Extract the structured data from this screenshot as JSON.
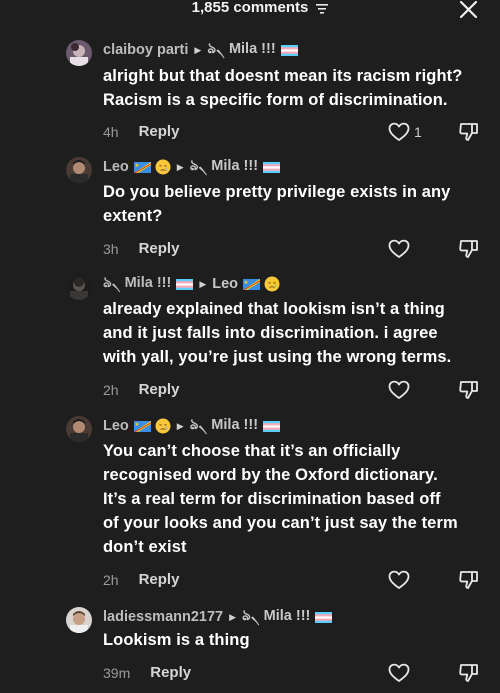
{
  "header": {
    "title": "1,855 comments"
  },
  "comments": [
    {
      "author": "claiboy parti",
      "reply_to": "ঌ৲ Mila !!!",
      "text_lines": [
        "alright but that doesnt mean its racism right?",
        "Racism is a specific form of discrimination."
      ],
      "time": "4h",
      "reply_label": "Reply",
      "like_count": "1"
    },
    {
      "author": "Leo",
      "reply_to": "ঌ৲ Mila !!!",
      "text_lines": [
        "Do you believe pretty privilege exists in any",
        "extent?"
      ],
      "time": "3h",
      "reply_label": "Reply",
      "like_count": ""
    },
    {
      "author": "ঌ৲ Mila !!!",
      "reply_to": "Leo",
      "text_lines": [
        "already explained that lookism isn’t a thing",
        "and it just falls into discrimination. i agree",
        "with yall, you’re just using the wrong terms."
      ],
      "time": "2h",
      "reply_label": "Reply",
      "like_count": ""
    },
    {
      "author": "Leo",
      "reply_to": "ঌ৲ Mila !!!",
      "text_lines": [
        "You can’t choose that it’s an officially",
        "recognised word by the Oxford dictionary.",
        "It’s a real term for discrimination based off",
        "of your looks and you can’t just say the term",
        "don’t exist"
      ],
      "time": "2h",
      "reply_label": "Reply",
      "like_count": ""
    },
    {
      "author": "ladiessmann2177",
      "reply_to": "ঌ৲ Mila !!!",
      "text_lines": [
        "Lookism is a thing"
      ],
      "time": "39m",
      "reply_label": "Reply",
      "like_count": ""
    }
  ],
  "colors": {
    "background": "#1e1e1e",
    "text": "#ffffff",
    "muted": "#9a9a9a",
    "username": "#bdbdbd"
  }
}
